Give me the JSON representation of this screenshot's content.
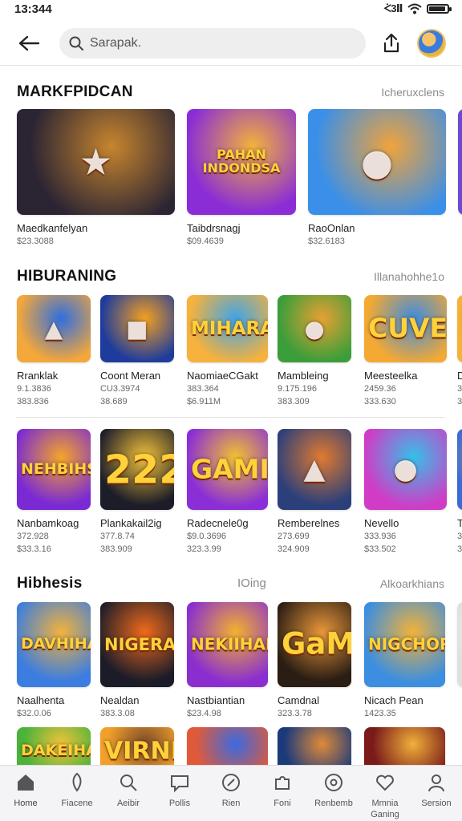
{
  "status_bar": {
    "time": "13:344",
    "network": "ᢵ3Ⅱ"
  },
  "search": {
    "placeholder": "Sarapak."
  },
  "sections": [
    {
      "title": "MARKFPIDCAN",
      "link": "Icheruxclens",
      "items": [
        {
          "title": "Maedkanfelyan",
          "sub": "$23.3088",
          "colors": [
            "#2a2433",
            "#c7852e"
          ],
          "glyph": "★"
        },
        {
          "title": "Taibdrsnagj",
          "sub": "$09.4639",
          "colors": [
            "#8a2dd6",
            "#f3b23a"
          ],
          "glyph": "PAHAN INDONDSA"
        },
        {
          "title": "RaoOnlan",
          "sub": "$32.6183",
          "colors": [
            "#3a8fe8",
            "#f0a33c"
          ],
          "glyph": "●"
        }
      ]
    },
    {
      "title": "HIBURANING",
      "link": "Illanahohhe1o",
      "rows": [
        [
          {
            "title": "Rranklak",
            "sub": "9.1.3836",
            "sub2": "383.836",
            "colors": [
              "#f4a73a",
              "#2f6ee0"
            ],
            "glyph": "▲"
          },
          {
            "title": "Coont Meran",
            "sub": "CU3.3974",
            "sub2": "38.689",
            "colors": [
              "#1f3c9c",
              "#f5a020"
            ],
            "glyph": "■"
          },
          {
            "title": "NaomiaeCGakt",
            "sub": "383.364",
            "sub2": "$6.911M",
            "colors": [
              "#f6b23c",
              "#3fa4e8"
            ],
            "glyph": "MIHARAH"
          },
          {
            "title": "Mambleing",
            "sub": "9.175.196",
            "sub2": "383.309",
            "colors": [
              "#3b9e3a",
              "#e8a033"
            ],
            "glyph": "●"
          },
          {
            "title": "Meesteelka",
            "sub": "2459.36",
            "sub2": "333.630",
            "colors": [
              "#f4a933",
              "#3d8be0"
            ],
            "glyph": "CUVES"
          },
          {
            "title": "D",
            "sub": "3",
            "sub2": "3",
            "colors": [
              "#f4b23a",
              "#e05a2e"
            ],
            "glyph": ""
          }
        ],
        [
          {
            "title": "Nanbamkoag",
            "sub": "372.928",
            "sub2": "$33.3.16",
            "colors": [
              "#7a2ad4",
              "#f5a528"
            ],
            "glyph": "NEHBIHSI"
          },
          {
            "title": "Plankakail2ig",
            "sub": "377.8.74",
            "sub2": "383.909",
            "colors": [
              "#1d1d2a",
              "#f0c13a"
            ],
            "glyph": "222"
          },
          {
            "title": "Radecnele0g",
            "sub": "$9.0.3696",
            "sub2": "323.3.99",
            "colors": [
              "#8a2ed8",
              "#f3c12e"
            ],
            "glyph": "GAMID"
          },
          {
            "title": "Remberelnes",
            "sub": "273.699",
            "sub2": "324.909",
            "colors": [
              "#2b3f7a",
              "#e07a30"
            ],
            "glyph": "▲"
          },
          {
            "title": "Nevello",
            "sub": "333.936",
            "sub2": "$33.502",
            "colors": [
              "#d03cc6",
              "#35c0e8"
            ],
            "glyph": "●"
          },
          {
            "title": "T",
            "sub": "3",
            "sub2": "3",
            "colors": [
              "#3a6ad8",
              "#f0b030"
            ],
            "glyph": ""
          }
        ]
      ]
    },
    {
      "title": "Hibhesis",
      "mid": "IOing",
      "link": "Alkoarkhians",
      "items": [
        {
          "title": "Naalhenta",
          "sub": "$32.0.06",
          "colors": [
            "#3b7de0",
            "#f2b23c"
          ],
          "glyph": "DAVHIHAN"
        },
        {
          "title": "Nealdan",
          "sub": "383.3.08",
          "colors": [
            "#1c1c28",
            "#f06a1c"
          ],
          "glyph": "NIGERAN"
        },
        {
          "title": "Nastbiantian",
          "sub": "$23.4.98",
          "colors": [
            "#8a2ed0",
            "#f3b22c"
          ],
          "glyph": "NEKIIHAN"
        },
        {
          "title": "Camdnal",
          "sub": "323.3.78",
          "colors": [
            "#2a1d14",
            "#e8963a"
          ],
          "glyph": "GaMe"
        },
        {
          "title": "Nicach Pean",
          "sub": "1423.35",
          "colors": [
            "#3b8ee0",
            "#f2b23a"
          ],
          "glyph": "NIGCHORN"
        },
        {
          "title": "",
          "sub": "",
          "colors": [
            "#e0e0e0",
            "#f5f5f5"
          ],
          "glyph": ""
        }
      ],
      "partial_row": [
        {
          "colors": [
            "#4bb33a",
            "#f2c23a"
          ],
          "glyph": "DAKEIHAN"
        },
        {
          "colors": [
            "#f2a02a",
            "#7a4a2a"
          ],
          "glyph": "VIRNI"
        },
        {
          "colors": [
            "#e05a3a",
            "#3a6ae0"
          ],
          "glyph": ""
        },
        {
          "colors": [
            "#1a3a7a",
            "#e08a3a"
          ],
          "glyph": ""
        },
        {
          "colors": [
            "#7a1a1a",
            "#f0b03a"
          ],
          "glyph": ""
        }
      ]
    }
  ],
  "bottom_nav": [
    {
      "label": "Home",
      "icon": "home-icon",
      "active": true
    },
    {
      "label": "Fiacene",
      "icon": "rocket-icon"
    },
    {
      "label": "Aeibir",
      "icon": "search-icon"
    },
    {
      "label": "Pollis",
      "icon": "chat-icon"
    },
    {
      "label": "Rien",
      "icon": "percent-icon"
    },
    {
      "label": "Foni",
      "icon": "puzzle-icon"
    },
    {
      "label": "Renbemb",
      "icon": "settings-circle-icon"
    },
    {
      "label": "Mmnia Ganing",
      "icon": "heart-icon"
    },
    {
      "label": "Sersion",
      "icon": "profile-icon"
    }
  ]
}
